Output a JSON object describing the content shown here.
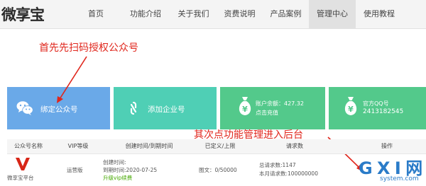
{
  "brand": {
    "logo_text": "微享宝"
  },
  "nav": {
    "items": [
      {
        "label": "首页"
      },
      {
        "label": "功能介绍"
      },
      {
        "label": "关于我们"
      },
      {
        "label": "资费说明"
      },
      {
        "label": "产品案例"
      },
      {
        "label": "管理中心"
      },
      {
        "label": "使用教程"
      }
    ],
    "active_index": 5
  },
  "annotations": {
    "step1": "首先先扫码授权公众号",
    "step2": "其次点功能管理进入后台"
  },
  "cards": {
    "bind": {
      "label": "绑定公众号"
    },
    "enterprise": {
      "label": "添加企业号"
    },
    "balance": {
      "title": "账户余额：427.32",
      "action": "点击充值"
    },
    "qq": {
      "title": "官方QQ号",
      "value": "2413182545"
    }
  },
  "table": {
    "headers": [
      "公众号名称",
      "VIP等级",
      "创建时间/到期时间",
      "已定义/上限",
      "请求数",
      "操作"
    ],
    "rows": [
      {
        "name": "微享宝平台",
        "vip": "运营版",
        "created": "创建时间:",
        "expires": "到期时间:2020-07-25",
        "upgrade": "升级vip续费",
        "defined": "图文：0/50000",
        "total_requests": "总请求数:1147",
        "month_requests": "本月请求数:100000000"
      }
    ]
  },
  "watermark": {
    "text": "G X I 网",
    "sub": "system.com"
  },
  "colors": {
    "annotation_red": "#e0261c",
    "card_blue": "#6aa9e8",
    "card_teal": "#4fcfb5",
    "card_green": "#53c98b",
    "upgrade_green": "#44a800"
  }
}
